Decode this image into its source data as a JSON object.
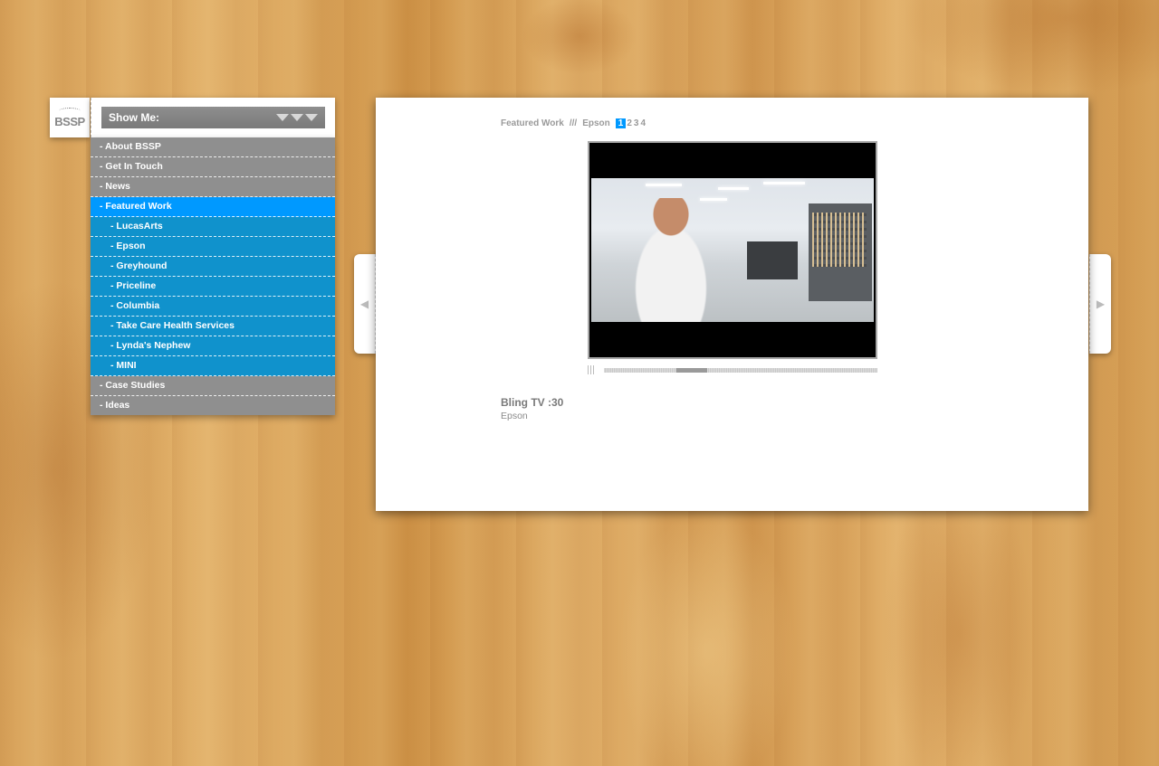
{
  "logo": {
    "text": "BSSP"
  },
  "showme": {
    "label": "Show Me:"
  },
  "menu": {
    "items": [
      {
        "label": "- About BSSP",
        "kind": "top"
      },
      {
        "label": "- Get In Touch",
        "kind": "top"
      },
      {
        "label": "- News",
        "kind": "top"
      },
      {
        "label": "- Featured Work",
        "kind": "active"
      },
      {
        "label": "- LucasArts",
        "kind": "sub"
      },
      {
        "label": "- Epson",
        "kind": "sub"
      },
      {
        "label": "- Greyhound",
        "kind": "sub"
      },
      {
        "label": "- Priceline",
        "kind": "sub"
      },
      {
        "label": "- Columbia",
        "kind": "sub"
      },
      {
        "label": "- Take Care Health Services",
        "kind": "sub"
      },
      {
        "label": "- Lynda's Nephew",
        "kind": "sub"
      },
      {
        "label": "- MINI",
        "kind": "sub"
      },
      {
        "label": "- Case Studies",
        "kind": "top"
      },
      {
        "label": "- Ideas",
        "kind": "top"
      }
    ]
  },
  "breadcrumb": {
    "section": "Featured Work",
    "separator": "///",
    "client": "Epson",
    "pages": [
      "1",
      "2",
      "3",
      "4"
    ],
    "current_page": "1"
  },
  "video": {
    "title": "Bling TV :30",
    "client": "Epson",
    "progress": 0.3
  },
  "icons": {
    "prev": "chevron-left-icon",
    "next": "chevron-right-icon",
    "dropdown": "triangle-down-icon"
  },
  "colors": {
    "active": "#0099ff",
    "sub": "#1092cc",
    "top": "#8f8f8f"
  }
}
